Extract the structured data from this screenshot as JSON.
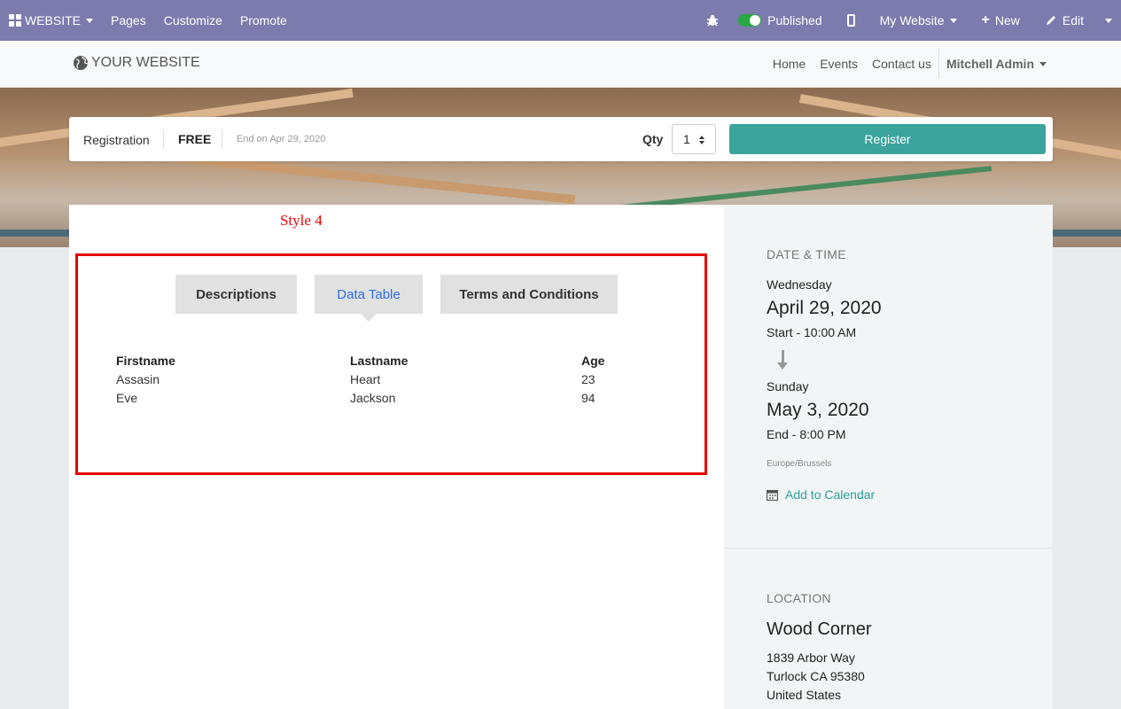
{
  "topbar": {
    "brand": "WEBSITE",
    "menu": [
      "Pages",
      "Customize",
      "Promote"
    ],
    "published_label": "Published",
    "site_selector": "My Website",
    "new_label": "New",
    "edit_label": "Edit"
  },
  "header": {
    "logo_text": "YOUR WEBSITE",
    "nav": [
      "Home",
      "Events",
      "Contact us"
    ],
    "user": "Mitchell Admin"
  },
  "registration": {
    "label": "Registration",
    "price": "FREE",
    "end_text": "End on Apr 29, 2020",
    "qty_label": "Qty",
    "qty_value": "1",
    "register_label": "Register"
  },
  "main": {
    "style_note": "Style 4",
    "tabs": [
      {
        "label": "Descriptions",
        "active": false
      },
      {
        "label": "Data Table",
        "active": true
      },
      {
        "label": "Terms and Conditions",
        "active": false
      }
    ],
    "table": {
      "headers": [
        "Firstname",
        "Lastname",
        "Age"
      ],
      "rows": [
        [
          "Assasin",
          "Heart",
          "23"
        ],
        [
          "Eve",
          "Jackson",
          "94"
        ]
      ]
    }
  },
  "sidebar": {
    "datetime_heading": "DATE & TIME",
    "start_day": "Wednesday",
    "start_date": "April 29, 2020",
    "start_time": "Start - 10:00 AM",
    "end_day": "Sunday",
    "end_date": "May 3, 2020",
    "end_time": "End - 8:00 PM",
    "timezone": "Europe/Brussels",
    "calendar_link": "Add to Calendar",
    "location_heading": "LOCATION",
    "venue": "Wood Corner",
    "address_line1": "1839 Arbor Way",
    "address_line2": "Turlock CA 95380",
    "address_line3": "United States"
  },
  "colors": {
    "topbar": "#7c7bad",
    "accent": "#3aa39c",
    "active_tab": "#2e6ee6",
    "highlight_box": "#e60000"
  }
}
